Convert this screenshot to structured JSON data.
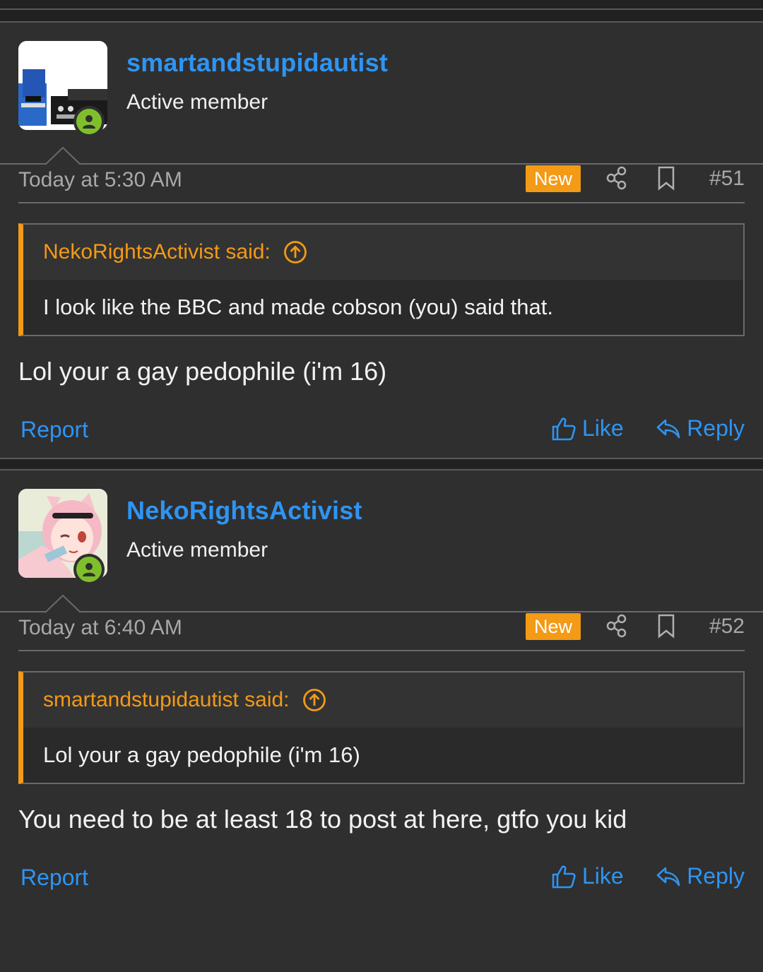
{
  "posts": [
    {
      "username": "smartandstupidautist",
      "user_title": "Active member",
      "avatar": "cars-avatar",
      "date": "Today at 5:30 AM",
      "new_label": "New",
      "post_number": "#51",
      "quote": {
        "author_line": "NekoRightsActivist said:",
        "text": "I look like the BBC and made cobson (you) said that."
      },
      "body": "Lol your a gay pedophile (i'm 16)",
      "actions": {
        "report": "Report",
        "like": "Like",
        "reply": "Reply"
      }
    },
    {
      "username": "NekoRightsActivist",
      "user_title": "Active member",
      "avatar": "anime-catgirl-avatar",
      "date": "Today at 6:40 AM",
      "new_label": "New",
      "post_number": "#52",
      "quote": {
        "author_line": "smartandstupidautist said:",
        "text": "Lol your a gay pedophile (i'm 16)"
      },
      "body": "You need to be at least 18 to post at here, gtfo you kid",
      "actions": {
        "report": "Report",
        "like": "Like",
        "reply": "Reply"
      }
    }
  ],
  "colors": {
    "link": "#2f94f2",
    "accent": "#f39a16",
    "online": "#7fbf2c",
    "background": "#2f2f2f"
  }
}
